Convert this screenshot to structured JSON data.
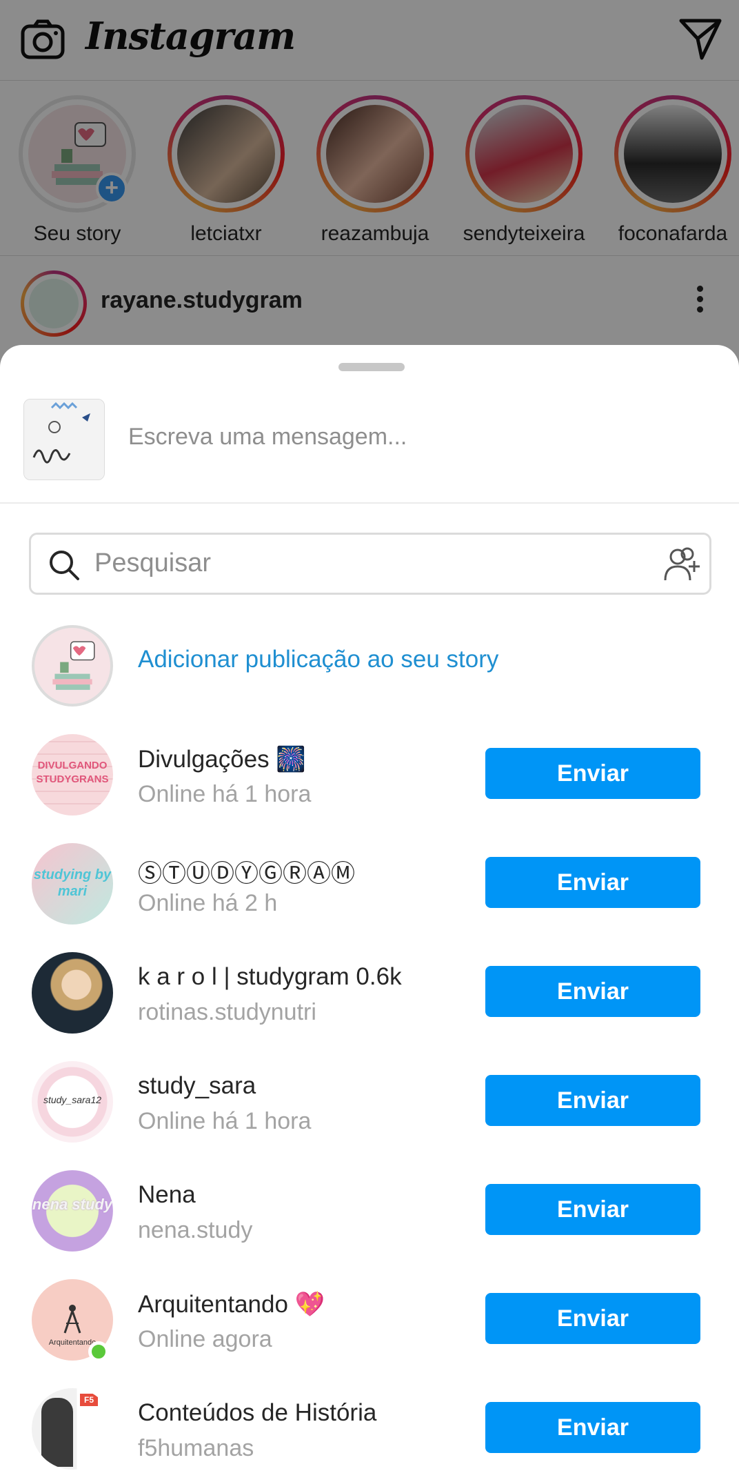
{
  "app": {
    "title": "Instagram"
  },
  "stories": [
    {
      "name": "Seu story",
      "own": true
    },
    {
      "name": "letciatxr"
    },
    {
      "name": "reazambuja"
    },
    {
      "name": "sendyteixeira"
    },
    {
      "name": "foconafarda"
    }
  ],
  "post": {
    "username": "rayane.studygram"
  },
  "share": {
    "message_placeholder": "Escreva uma mensagem...",
    "search_placeholder": "Pesquisar",
    "add_to_story_label": "Adicionar publicação ao seu story",
    "send_label": "Enviar",
    "recipients": [
      {
        "title": "Divulgações 🎆",
        "subtitle": "Online há 1 hora",
        "avatar_text": "DIVULGANDO STUDYGRANS",
        "online": false
      },
      {
        "title": "ⓈⓉⓊⒹⓎⒼⓇⒶⓂ",
        "subtitle": "Online há 2 h",
        "avatar_text": "studying by mari",
        "online": false
      },
      {
        "title": "k a r o l | studygram 0.6k",
        "subtitle": "rotinas.studynutri",
        "online": false
      },
      {
        "title": "study_sara",
        "subtitle": "Online há 1 hora",
        "avatar_text": "study_sara12",
        "online": false
      },
      {
        "title": "Nena",
        "subtitle": "nena.study",
        "avatar_text": "nena study",
        "online": false
      },
      {
        "title": "Arquitentando 💖",
        "subtitle": "Online agora",
        "avatar_text": "Arquitentando",
        "online": true
      },
      {
        "title": "Conteúdos de História",
        "subtitle": "f5humanas",
        "avatar_text": "F5",
        "online": false
      }
    ]
  },
  "colors": {
    "primary": "#0095f6",
    "link": "#1f8fd1",
    "online": "#5ac93a"
  },
  "icons": [
    "camera-icon",
    "direct-message-icon",
    "search-icon",
    "add-people-icon",
    "more-options-icon",
    "plus-icon"
  ]
}
